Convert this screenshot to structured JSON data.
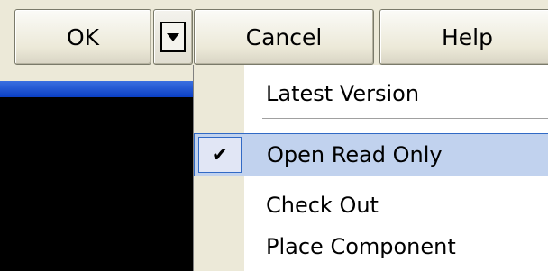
{
  "buttons": {
    "ok_label": "OK",
    "cancel_label": "Cancel",
    "help_label": "Help",
    "dropdown_icon": "dropdown-arrow-icon"
  },
  "menu": {
    "items": [
      {
        "label": "Latest Version",
        "checked": false,
        "selected": false
      },
      {
        "label": "Open Read Only",
        "checked": true,
        "selected": true
      },
      {
        "label": "Check Out",
        "checked": false,
        "selected": false
      },
      {
        "label": "Place Component",
        "checked": false,
        "selected": false
      }
    ],
    "check_glyph": "✔"
  },
  "colors": {
    "dialog_face": "#ece9d8",
    "highlight_fill": "#c1d2ee",
    "highlight_border": "#316ac5",
    "title_bar_blue": "#0a3fc4"
  }
}
